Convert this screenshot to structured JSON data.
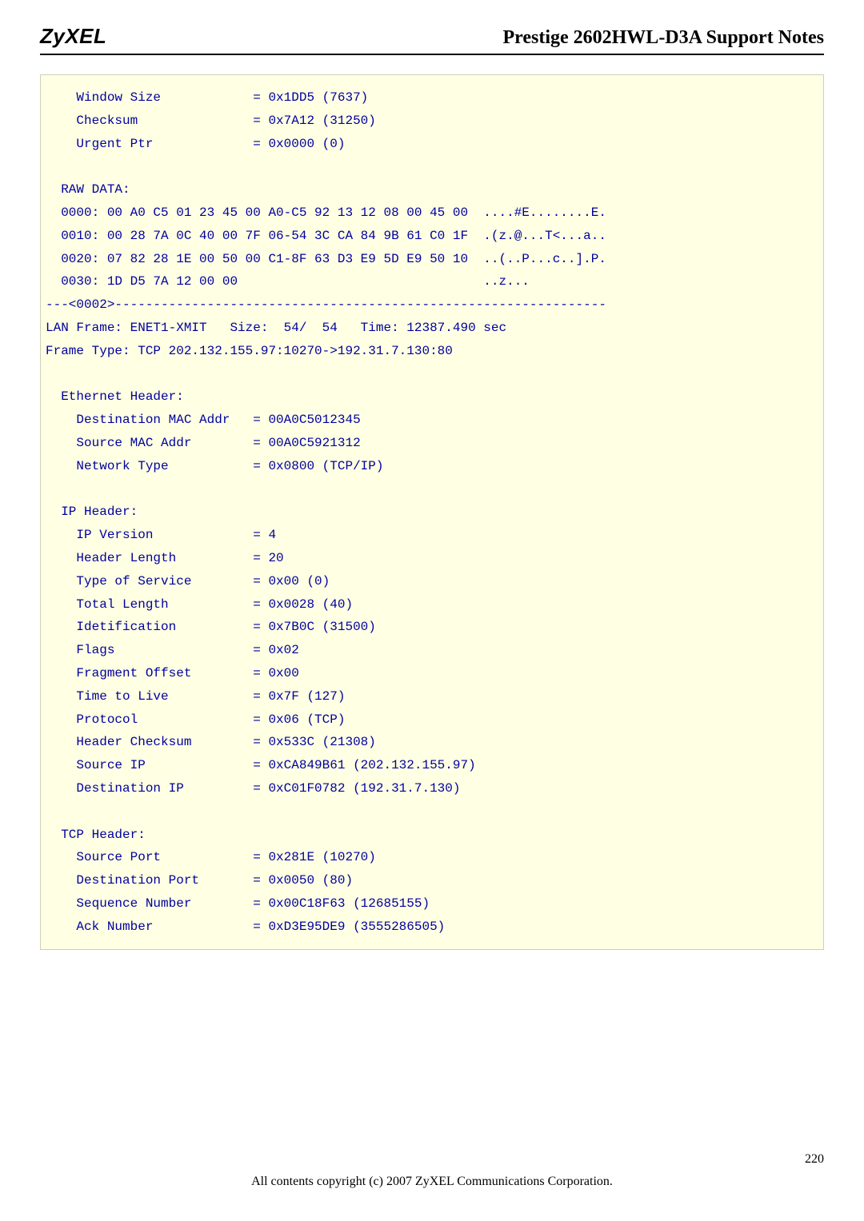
{
  "header": {
    "logo": "ZyXEL",
    "doc_title": "Prestige 2602HWL-D3A Support Notes"
  },
  "code": [
    "    Window Size            = 0x1DD5 (7637)",
    "    Checksum               = 0x7A12 (31250)",
    "    Urgent Ptr             = 0x0000 (0)",
    "",
    "  RAW DATA:",
    "  0000: 00 A0 C5 01 23 45 00 A0-C5 92 13 12 08 00 45 00  ....#E........E.",
    "  0010: 00 28 7A 0C 40 00 7F 06-54 3C CA 84 9B 61 C0 1F  .(z.@...T<...a..",
    "  0020: 07 82 28 1E 00 50 00 C1-8F 63 D3 E9 5D E9 50 10  ..(..P...c..].P.",
    "  0030: 1D D5 7A 12 00 00                                ..z...",
    "---<0002>----------------------------------------------------------------",
    "LAN Frame: ENET1-XMIT   Size:  54/  54   Time: 12387.490 sec",
    "Frame Type: TCP 202.132.155.97:10270->192.31.7.130:80",
    "",
    "  Ethernet Header:",
    "    Destination MAC Addr   = 00A0C5012345",
    "    Source MAC Addr        = 00A0C5921312",
    "    Network Type           = 0x0800 (TCP/IP)",
    "",
    "  IP Header:",
    "    IP Version             = 4",
    "    Header Length          = 20",
    "    Type of Service        = 0x00 (0)",
    "    Total Length           = 0x0028 (40)",
    "    Idetification          = 0x7B0C (31500)",
    "    Flags                  = 0x02",
    "    Fragment Offset        = 0x00",
    "    Time to Live           = 0x7F (127)",
    "    Protocol               = 0x06 (TCP)",
    "    Header Checksum        = 0x533C (21308)",
    "    Source IP              = 0xCA849B61 (202.132.155.97)",
    "    Destination IP         = 0xC01F0782 (192.31.7.130)",
    "",
    "  TCP Header:",
    "    Source Port            = 0x281E (10270)",
    "    Destination Port       = 0x0050 (80)",
    "    Sequence Number        = 0x00C18F63 (12685155)",
    "    Ack Number             = 0xD3E95DE9 (3555286505)"
  ],
  "footer": {
    "copyright": "All contents copyright (c) 2007 ZyXEL Communications Corporation.",
    "page_number": "220"
  }
}
